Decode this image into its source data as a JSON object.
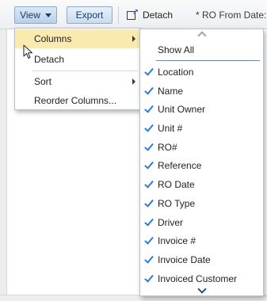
{
  "toolbar": {
    "view_label": "View",
    "export_label": "Export",
    "detach_label": "Detach",
    "ro_from_date_label": "* RO From Date:"
  },
  "view_menu": {
    "items": [
      {
        "label": "Columns",
        "has_submenu": true,
        "highlighted": true
      },
      {
        "label": "Detach",
        "has_submenu": false,
        "highlighted": false
      },
      {
        "label": "Sort",
        "has_submenu": true,
        "highlighted": false
      },
      {
        "label": "Reorder Columns...",
        "has_submenu": false,
        "highlighted": false
      }
    ]
  },
  "columns_menu": {
    "show_all_label": "Show All",
    "columns": [
      {
        "label": "Location",
        "checked": true
      },
      {
        "label": "Name",
        "checked": true
      },
      {
        "label": "Unit Owner",
        "checked": true
      },
      {
        "label": "Unit #",
        "checked": true
      },
      {
        "label": "RO#",
        "checked": true
      },
      {
        "label": "Reference",
        "checked": true
      },
      {
        "label": "RO Date",
        "checked": true
      },
      {
        "label": "RO Type",
        "checked": true
      },
      {
        "label": "Driver",
        "checked": true
      },
      {
        "label": "Invoice #",
        "checked": true
      },
      {
        "label": "Invoice Date",
        "checked": true
      },
      {
        "label": "Invoiced Customer",
        "checked": true
      }
    ]
  },
  "icons": {
    "view_caret": "chevron-down-icon",
    "detach": "detach-window-icon",
    "submenu": "chevron-right-icon",
    "check": "checkmark-icon",
    "scroll_up": "scroll-up-icon",
    "scroll_down": "scroll-down-icon",
    "pointer": "mouse-pointer-icon"
  },
  "colors": {
    "highlight": "#fbeab0",
    "check": "#2d7cd6",
    "button_border": "#8fa9c4"
  }
}
